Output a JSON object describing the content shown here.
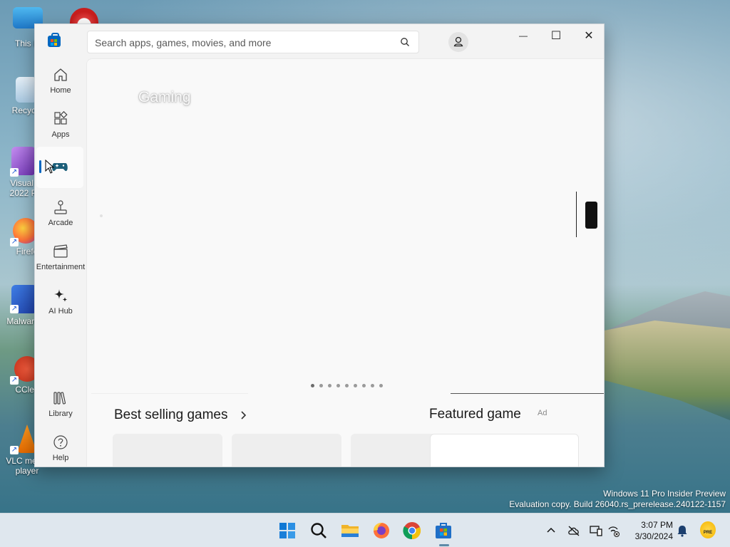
{
  "desktop": {
    "icons": [
      {
        "label": "This P"
      },
      {
        "label": "Recycle"
      },
      {
        "label": "Visual St\n2022 Pre"
      },
      {
        "label": "Firefo"
      },
      {
        "label": "Malware"
      },
      {
        "label": "CClea"
      },
      {
        "label": "VLC media\nplayer"
      }
    ],
    "watermark_line1": "Windows 11 Pro Insider Preview",
    "watermark_line2": "Evaluation copy. Build 26040.rs_prerelease.240122-1157"
  },
  "window": {
    "search_placeholder": "Search apps, games, movies, and more",
    "controls": {
      "minimize": "—",
      "maximize": "☐",
      "close": "✕"
    },
    "nav": [
      {
        "label": "Home",
        "icon": "home-icon"
      },
      {
        "label": "Apps",
        "icon": "apps-icon"
      },
      {
        "label": "",
        "icon": "gaming-controller-icon",
        "active": true
      },
      {
        "label": "Arcade",
        "icon": "joystick-icon"
      },
      {
        "label": "Entertainment",
        "icon": "clapperboard-icon"
      },
      {
        "label": "AI Hub",
        "icon": "sparkle-icon"
      },
      {
        "label": "Library",
        "icon": "library-icon"
      },
      {
        "label": "Help",
        "icon": "help-icon"
      }
    ],
    "hero": {
      "title": "Gaming",
      "dots": 9,
      "active_dot": 0
    },
    "sections": {
      "best_selling": "Best selling games",
      "featured": "Featured game",
      "ad_tag": "Ad"
    }
  },
  "taskbar": {
    "apps": [
      "start-icon",
      "search-icon",
      "file-explorer-icon",
      "firefox-icon",
      "chrome-icon",
      "store-icon"
    ],
    "time": "3:07 PM",
    "date": "3/30/2024",
    "badge": "PRE"
  }
}
